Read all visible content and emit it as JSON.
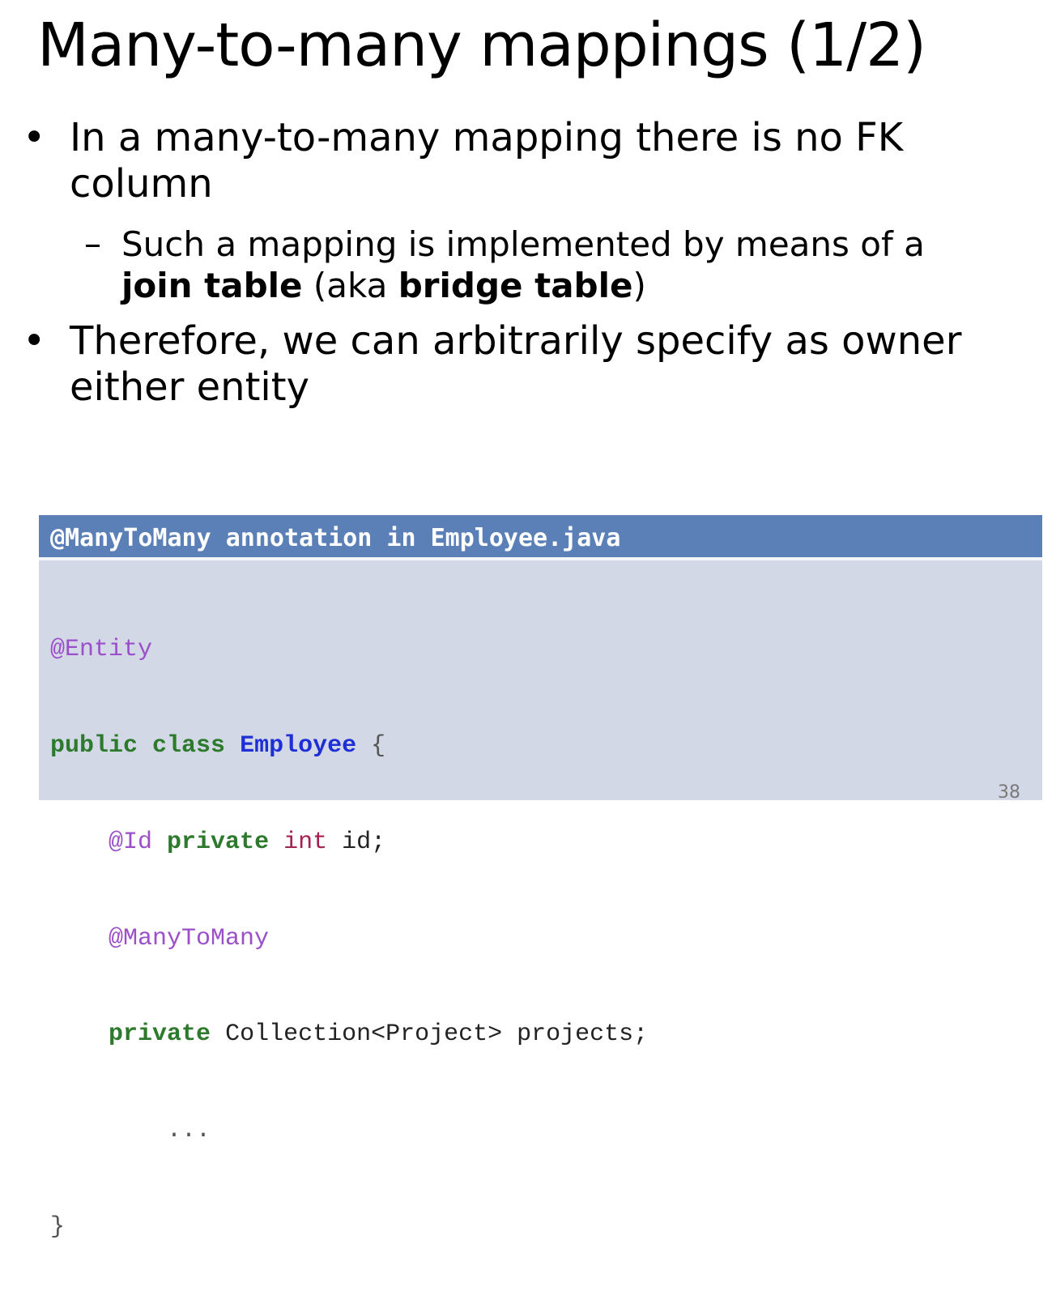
{
  "slide": {
    "title": "Many-to-many mappings (1/2)",
    "page_number": "38"
  },
  "bullets": [
    {
      "marker": "•",
      "line1": "In a many-to-many mapping there is no FK",
      "line2": "column"
    },
    {
      "marker": "–",
      "line1": "Such a mapping is implemented by means of a",
      "line2_bold1": "join table",
      "line2_plain1": " (aka ",
      "line2_bold2": "bridge table",
      "line2_plain2": ")"
    },
    {
      "marker": "•",
      "line1": "Therefore, we can arbitrarily specify as owner",
      "line2": "either entity"
    }
  ],
  "code_box": {
    "header": "@ManyToMany annotation in Employee.java",
    "lines": {
      "l1_ann": "@Entity",
      "l2_kw": "public class",
      "l2_cls": "Employee",
      "l2_brace": "{",
      "l3_ann": "@Id",
      "l3_kw": "private",
      "l3_typ": "int",
      "l3_rest": "id;",
      "l4_ann": "@ManyToMany",
      "l5_kw": "private",
      "l5_rest": "Collection<Project> projects;",
      "l6_ellipsis": "...",
      "l7_brace": "}"
    }
  },
  "colors": {
    "header_bg": "#5b80b7",
    "code_bg": "#d3d8e6",
    "annotation": "#9b4fc9",
    "keyword": "#2d7a2d",
    "class_name": "#1f2fd6",
    "type": "#a3214c"
  }
}
